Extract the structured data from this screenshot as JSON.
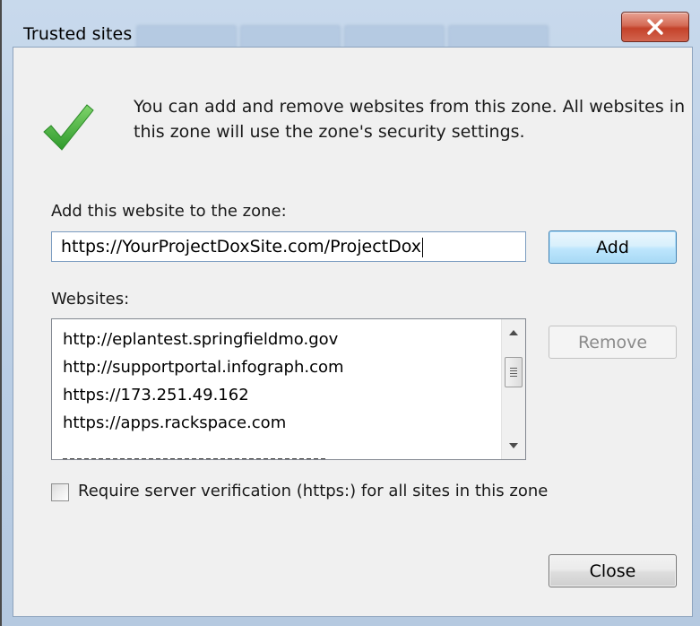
{
  "window": {
    "title": "Trusted sites",
    "close_icon": "close-x-icon"
  },
  "info": {
    "icon": "green-checkmark-icon",
    "text_line1": "You can add and remove websites from this zone. All websites in",
    "text_line2": "this zone will use the zone's security settings."
  },
  "add_section": {
    "label": "Add this website to the zone:",
    "input_value": "https://YourProjectDoxSite.com/ProjectDox",
    "add_label": "Add"
  },
  "websites": {
    "label": "Websites:",
    "items": [
      "http://eplantest.springfieldmo.gov",
      "http://supportportal.infograph.com",
      "https://173.251.49.162",
      "https://apps.rackspace.com"
    ],
    "remove_label": "Remove"
  },
  "verification": {
    "label": "Require server verification (https:) for all sites in this zone",
    "checked": false
  },
  "footer": {
    "close_label": "Close"
  },
  "colors": {
    "check_green": "#3fae3a",
    "window_frame": "#b9cde4",
    "close_red": "#c4422a"
  }
}
